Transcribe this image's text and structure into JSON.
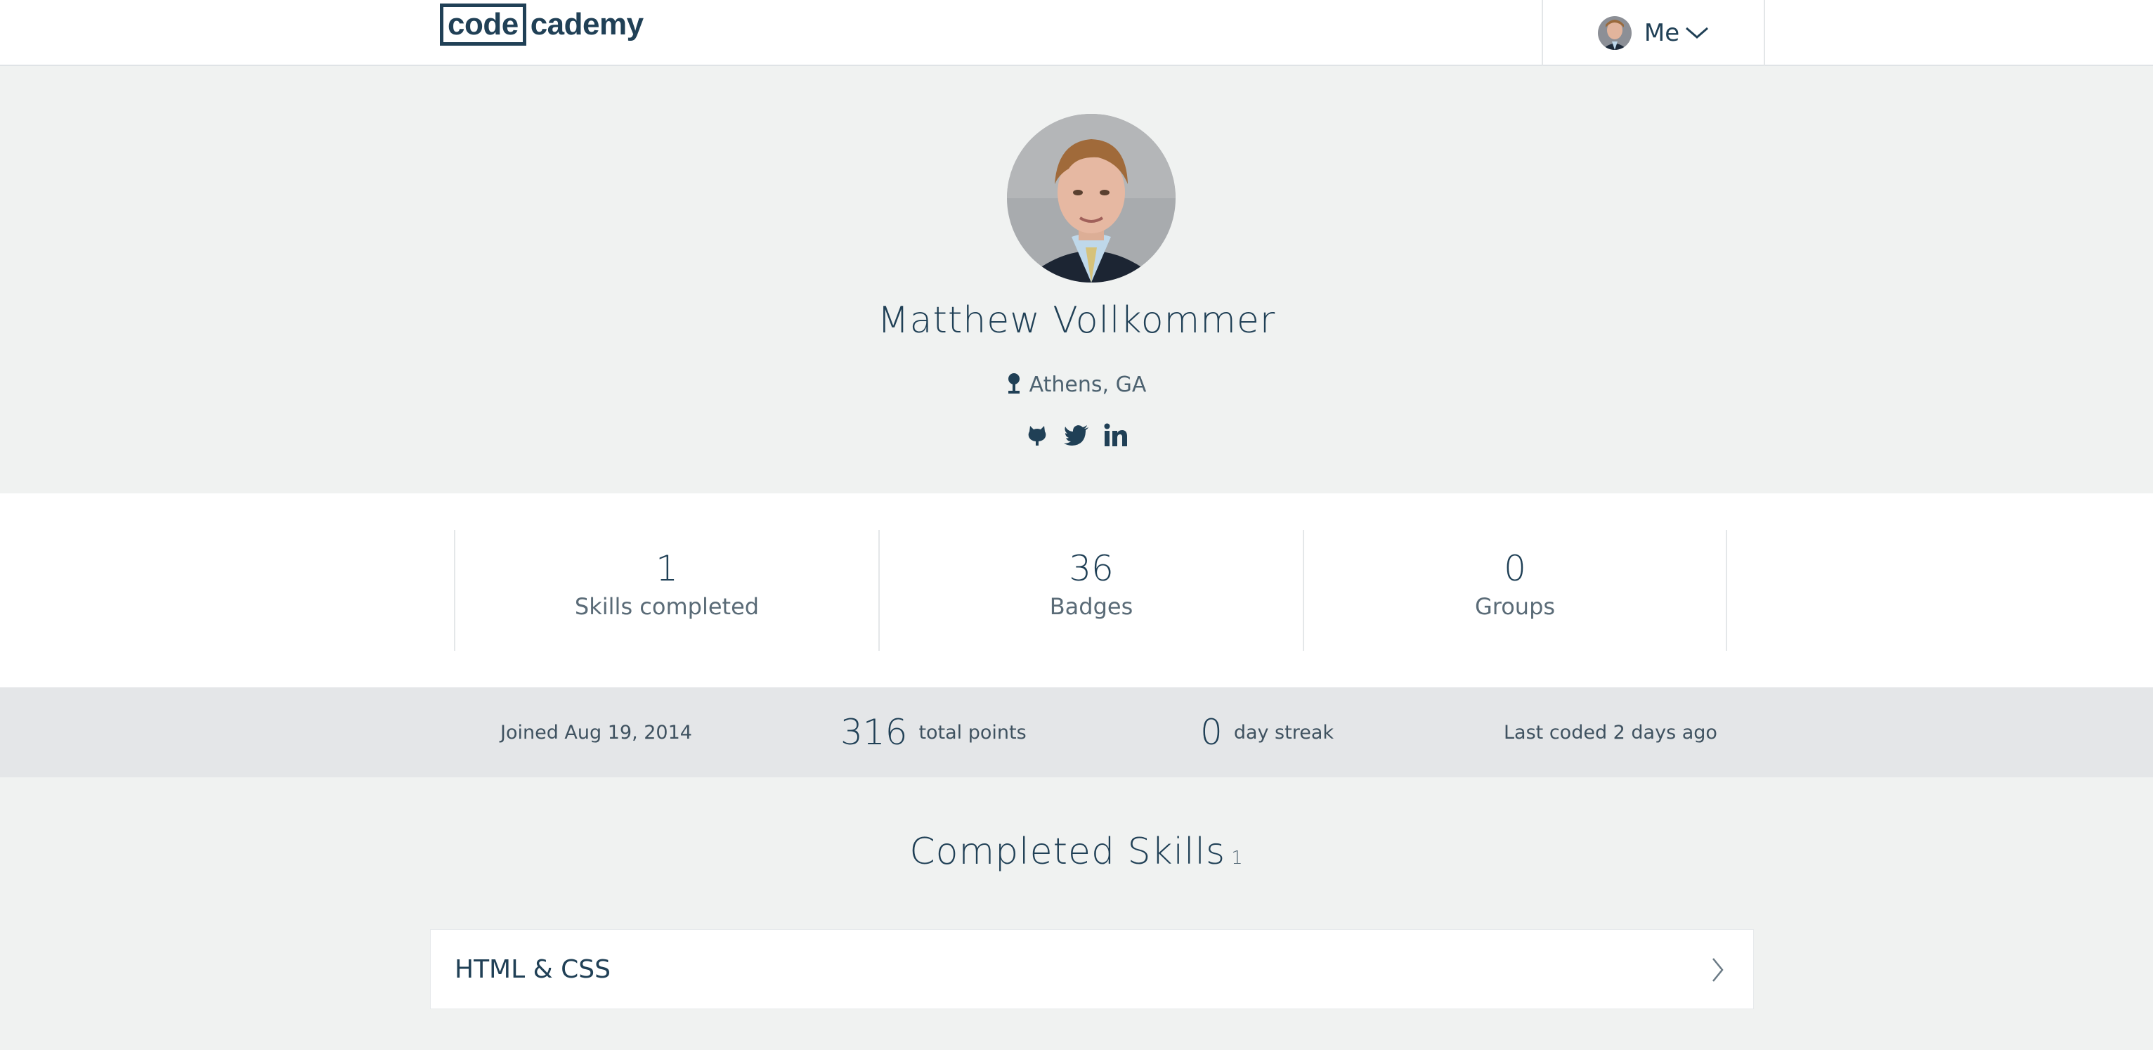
{
  "header": {
    "logo_boxed": "code",
    "logo_rest": "cademy",
    "me_label": "Me"
  },
  "profile": {
    "name": "Matthew Vollkommer",
    "location": "Athens, GA",
    "social_icons": [
      "github-icon",
      "twitter-icon",
      "linkedin-icon"
    ]
  },
  "stats": [
    {
      "value": "1",
      "label": "Skills completed"
    },
    {
      "value": "36",
      "label": "Badges"
    },
    {
      "value": "0",
      "label": "Groups"
    }
  ],
  "summary": {
    "joined": "Joined Aug 19, 2014",
    "total_points_value": "316",
    "total_points_label": "total points",
    "streak_value": "0",
    "streak_label": "day streak",
    "last_coded": "Last coded 2 days ago"
  },
  "completed_skills": {
    "title": "Completed Skills",
    "count": "1",
    "items": [
      {
        "name": "HTML & CSS"
      }
    ]
  },
  "colors": {
    "brand": "#204056",
    "page_bg": "#f0f2f1",
    "strip_bg": "#e4e6e8",
    "card_bg": "#ffffff"
  }
}
